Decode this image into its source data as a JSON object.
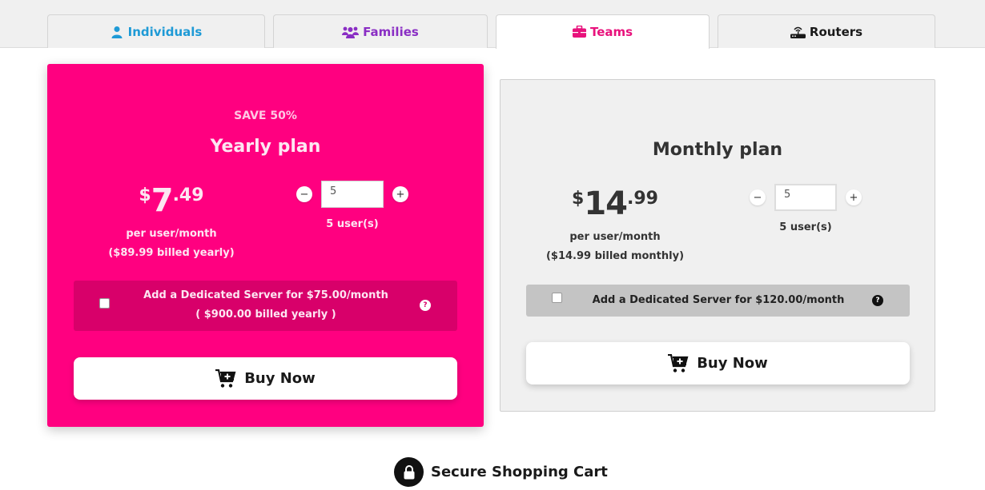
{
  "tabs": [
    {
      "label": "Individuals",
      "icon": "user-icon",
      "color": "#1e9ad6",
      "active": false
    },
    {
      "label": "Families",
      "icon": "users-icon",
      "color": "#8a2ec4",
      "active": false
    },
    {
      "label": "Teams",
      "icon": "briefcase-icon",
      "color": "#e8127c",
      "active": true
    },
    {
      "label": "Routers",
      "icon": "router-icon",
      "color": "#1a1a1a",
      "active": false
    }
  ],
  "yearly": {
    "badge": "SAVE 50%",
    "title": "Yearly plan",
    "price": {
      "currency": "$",
      "whole": "7",
      "cents": ".49"
    },
    "per": "per user/month",
    "billed": "($89.99 billed yearly)",
    "quantity": "5",
    "minus": "−",
    "plus": "+",
    "users": "5 user(s)",
    "server_line1": "Add a Dedicated Server for $75.00/month",
    "server_line2": "( $900.00 billed yearly )",
    "server_checked": false,
    "help": "?",
    "buy": "Buy Now",
    "accent": "#ff0080"
  },
  "monthly": {
    "title": "Monthly plan",
    "price": {
      "currency": "$",
      "whole": "14",
      "cents": ".99"
    },
    "per": "per user/month",
    "billed": "($14.99 billed monthly)",
    "quantity": "5",
    "minus": "−",
    "plus": "+",
    "users": "5 user(s)",
    "server_line1": "Add a Dedicated Server for $120.00/month",
    "server_checked": false,
    "help": "?",
    "buy": "Buy Now"
  },
  "footer": {
    "secure_label": "Secure Shopping Cart",
    "icon": "lock-icon"
  }
}
